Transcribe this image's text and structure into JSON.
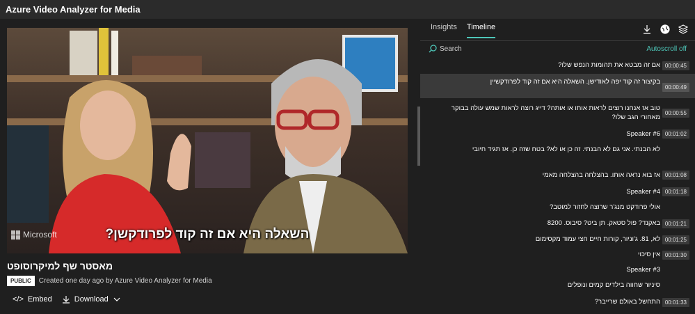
{
  "app": {
    "title": "Azure Video Analyzer for Media"
  },
  "player": {
    "subtitle": "השאלה היא אם זה קוד לפרודקשן?",
    "watermark": "Microsoft"
  },
  "video": {
    "title": "מאסטר שף למיקרוסופט",
    "badge": "PUBLIC",
    "created": "Created one day ago by Azure Video Analyzer for Media"
  },
  "actions": {
    "embed": "Embed",
    "download": "Download"
  },
  "panel": {
    "tabs": [
      {
        "label": "Insights"
      },
      {
        "label": "Timeline"
      }
    ],
    "search_placeholder": "Search",
    "autoscroll": "Autoscroll off"
  },
  "timeline": [
    {
      "text": "אם זה מבטא את תהומות הנפש שלו?",
      "ts": "00:00:45"
    },
    {
      "text": "בקיצור זה קוד יפה לאודישן. השאלה היא אם זה קוד לפרודקשיין",
      "ts": "00:00:49"
    },
    {
      "text": "טוב אז אנחנו רוצים לראות אותו או אותה? דייג רוצה לראות שמש עולה בבוקר מאחורי הגב שלו?",
      "ts": "00:00:55"
    },
    {
      "text": "Speaker #6",
      "ts": "00:01:02"
    },
    {
      "text": "לא הבנתי. אני גם לא הבנתי. זה כן או לא? בטח שזה כן. אז תגיד חיובי",
      "ts": ""
    },
    {
      "text": "אז בוא נראה אותו. בהצלחה בהצלחה מאמי",
      "ts": "00:01:08"
    },
    {
      "text": "Speaker #4",
      "ts": "00:01:18"
    },
    {
      "text": "אולי פרודקט מנג'ר שרוצה לחזור למוטב?",
      "ts": ""
    },
    {
      "text": "באקנד? פול סטאק. תן ביט? סיבוס. 8200",
      "ts": "00:01:21"
    },
    {
      "text": "לא, 81. ג'וניור, קורות חיים חצי עמוד מקסימום",
      "ts": "00:01:25"
    },
    {
      "text": "אין סיכוי",
      "ts": "00:01:30"
    },
    {
      "text": "Speaker #3",
      "ts": ""
    },
    {
      "text": "סיניור שחווה בילדים קמים ונופלים",
      "ts": ""
    },
    {
      "text": "התחשל באולם שרייבר?",
      "ts": "00:01:33"
    }
  ],
  "colors": {
    "accent": "#4ec6b8",
    "background": "#1f1f1f"
  }
}
